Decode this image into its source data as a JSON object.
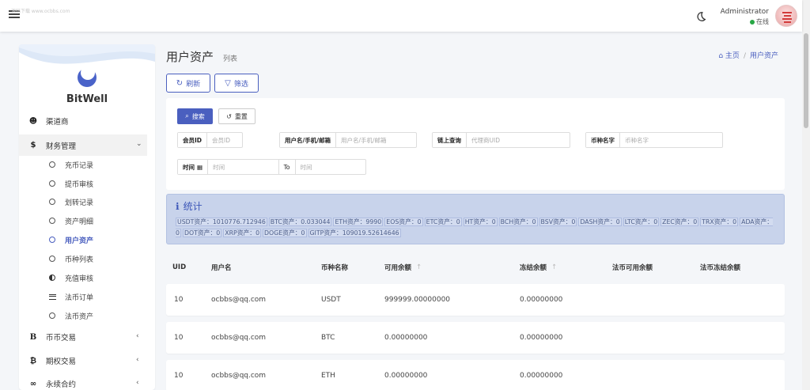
{
  "topbar": {
    "watermark": "源码下载 www.ocbbs.com",
    "user_name": "Administrator",
    "user_status": "在线"
  },
  "sidebar": {
    "brand": "BitWell",
    "items": [
      {
        "label": "渠道商",
        "icon": "users-icon"
      },
      {
        "label": "财务管理",
        "icon": "dollar-icon"
      },
      {
        "label": "币币交易",
        "icon": "bitcoin-icon"
      },
      {
        "label": "期权交易",
        "icon": "bitcoin-icon"
      },
      {
        "label": "永续合约",
        "icon": "link-icon"
      }
    ],
    "subitems": [
      {
        "label": "充币记录"
      },
      {
        "label": "提币审核"
      },
      {
        "label": "划转记录"
      },
      {
        "label": "资产明细"
      },
      {
        "label": "用户资产"
      },
      {
        "label": "币种列表"
      },
      {
        "label": "充值审核"
      },
      {
        "label": "法币订单"
      },
      {
        "label": "法币资产"
      }
    ]
  },
  "page": {
    "title": "用户资产",
    "subtitle": "列表",
    "breadcrumb": [
      "主页",
      "用户资产"
    ]
  },
  "toolbar": {
    "refresh_label": "刷新",
    "filter_label": "筛选"
  },
  "search": {
    "search_label": "搜索",
    "reset_label": "重置",
    "fields": [
      {
        "label": "会员ID",
        "placeholder": "会员ID"
      },
      {
        "label": "用户名/手机/邮箱",
        "placeholder": "用户名/手机/邮箱"
      },
      {
        "label": "链上查询",
        "placeholder": "代理商UID"
      },
      {
        "label": "币种名字",
        "placeholder": "币种名字"
      },
      {
        "label": "时间",
        "placeholder": "时间"
      },
      {
        "label": "To",
        "placeholder": "时间"
      }
    ]
  },
  "stats": {
    "title": "统计",
    "items": [
      "USDT资产：1010776.712946",
      "BTC资产：0.033044",
      "ETH资产：9990",
      "EOS资产：0",
      "ETC资产：0",
      "HT资产：0",
      "BCH资产：0",
      "BSV资产：0",
      "DASH资产：0",
      "LTC资产：0",
      "ZEC资产：0",
      "TRX资产：0",
      "ADA资产：0",
      "DOT资产：0",
      "XRP资产：0",
      "DOGE资产：0",
      "GITP资产：109019.52614646"
    ]
  },
  "table": {
    "headers": [
      "UID",
      "用户名",
      "币种名称",
      "可用余额",
      "冻结余额",
      "法币可用余额",
      "法币冻结余额"
    ],
    "rows": [
      [
        "10",
        "ocbbs@qq.com",
        "USDT",
        "999999.00000000",
        "0.00000000",
        "",
        ""
      ],
      [
        "10",
        "ocbbs@qq.com",
        "BTC",
        "0.00000000",
        "0.00000000",
        "",
        ""
      ],
      [
        "10",
        "ocbbs@qq.com",
        "ETH",
        "0.00000000",
        "0.00000000",
        "",
        ""
      ]
    ]
  },
  "colors": {
    "accent": "#4a5fbf",
    "stats_bg": "#c8d3eb",
    "online": "#28a745"
  }
}
